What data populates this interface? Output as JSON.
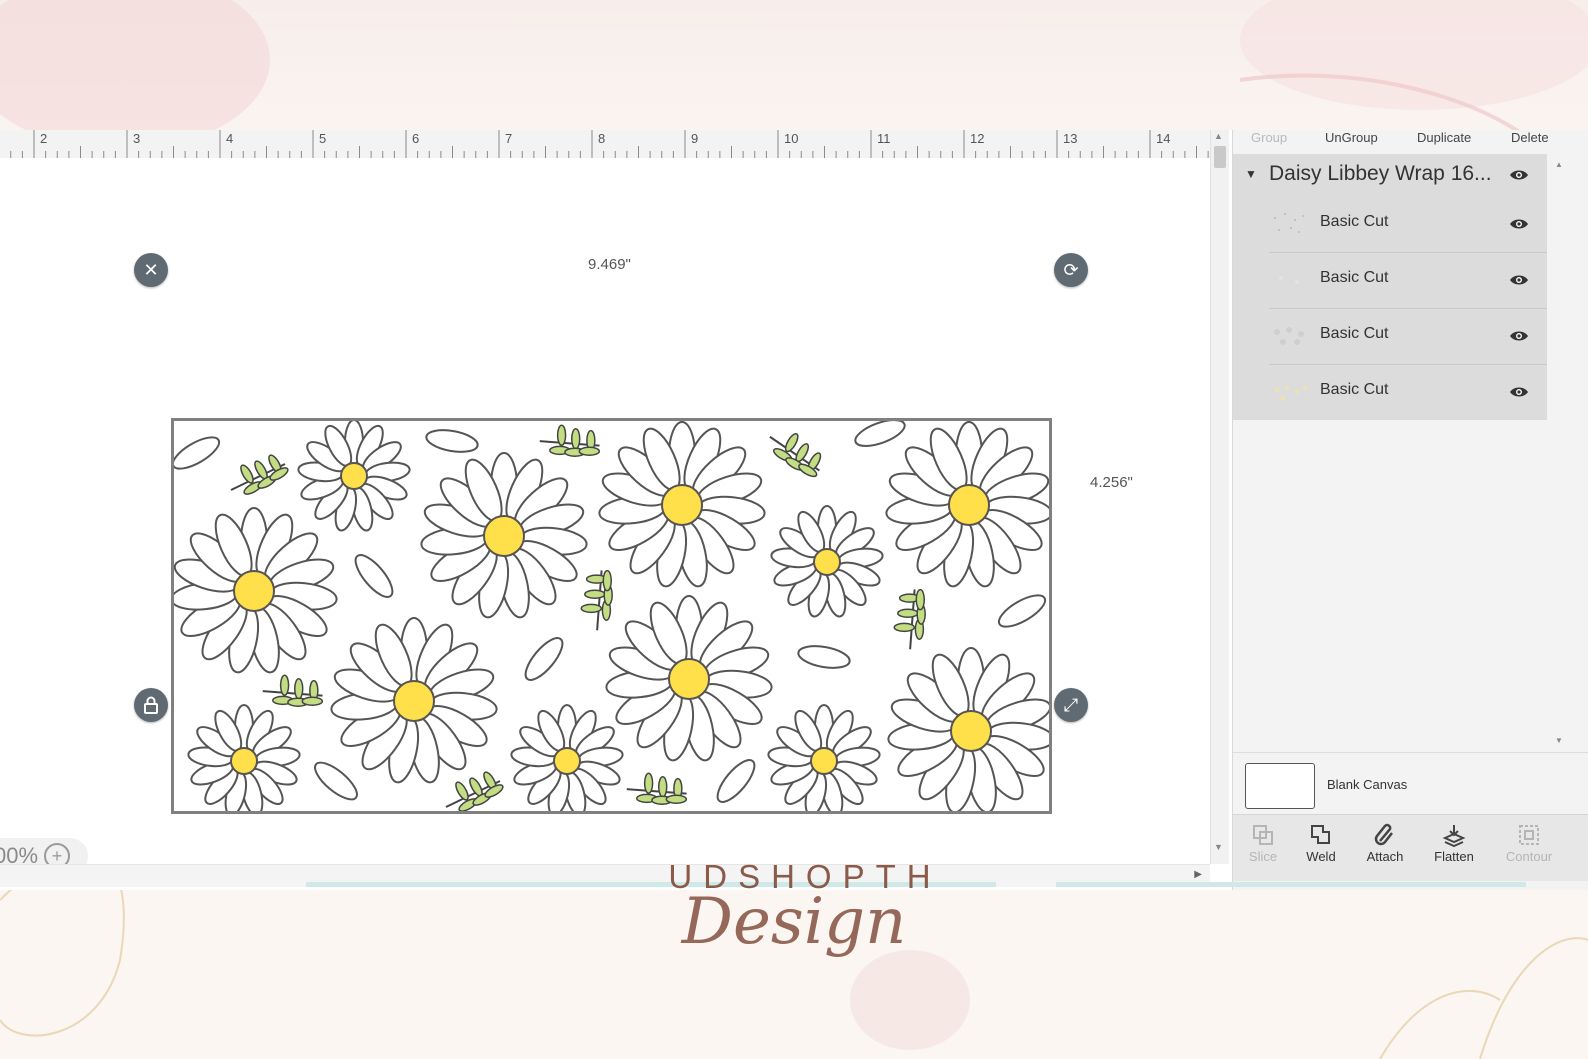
{
  "ruler": {
    "marks": [
      "2",
      "3",
      "4",
      "5",
      "6",
      "7",
      "8",
      "9",
      "10",
      "11",
      "12",
      "13",
      "14"
    ]
  },
  "canvas": {
    "width_label": "9.469\"",
    "height_label": "4.256\"",
    "zoom": "00%",
    "zoom_in_label": "+"
  },
  "panel": {
    "toolbar": {
      "group": "Group",
      "ungroup": "UnGroup",
      "duplicate": "Duplicate",
      "delete": "Delete"
    },
    "group_title": "Daisy Libbey Wrap 16...",
    "layers": [
      {
        "name": "Basic Cut"
      },
      {
        "name": "Basic Cut"
      },
      {
        "name": "Basic Cut"
      },
      {
        "name": "Basic Cut"
      }
    ],
    "blank_canvas_label": "Blank Canvas",
    "tools": [
      {
        "label": "Slice",
        "icon": "slice-icon",
        "enabled": false
      },
      {
        "label": "Weld",
        "icon": "weld-icon",
        "enabled": true
      },
      {
        "label": "Attach",
        "icon": "attach-icon",
        "enabled": true
      },
      {
        "label": "Flatten",
        "icon": "flatten-icon",
        "enabled": true
      },
      {
        "label": "Contour",
        "icon": "contour-icon",
        "enabled": false
      }
    ]
  },
  "brand": {
    "name": "UDSHOPTH",
    "script": "Design"
  },
  "colors": {
    "daisy_center": "#ffe04a",
    "leaf": "#c3dd83",
    "handle": "#5f6a72",
    "brand": "#8b5a48"
  }
}
